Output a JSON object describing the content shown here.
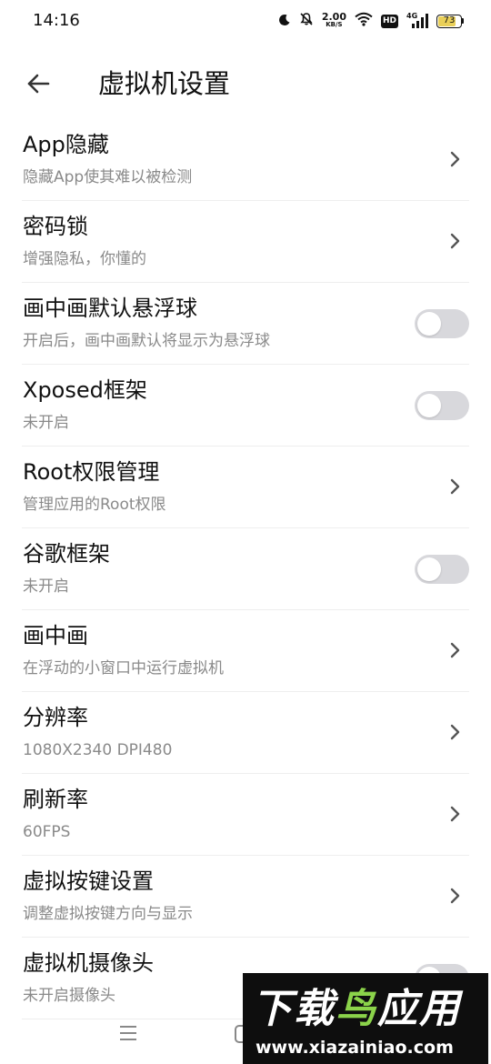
{
  "status_bar": {
    "time": "14:16",
    "speed_value": "2.00",
    "speed_unit": "KB/S",
    "hd_label": "HD",
    "network_label": "4G",
    "battery_level": "73",
    "battery_fill_fraction": 0.73,
    "battery_color": "#e9cf58",
    "icons": [
      "moon-icon",
      "bell-off-icon",
      "wifi-icon",
      "signal-icon",
      "battery-icon"
    ]
  },
  "header": {
    "title": "虚拟机设置",
    "back_icon": "back-arrow-icon"
  },
  "settings": [
    {
      "id": "app-hide",
      "title": "App隐藏",
      "subtitle": "隐藏App使其难以被检测",
      "control": "chevron"
    },
    {
      "id": "password-lock",
      "title": "密码锁",
      "subtitle": "增强隐私，你懂的",
      "control": "chevron"
    },
    {
      "id": "pip-float-ball",
      "title": "画中画默认悬浮球",
      "subtitle": "开启后，画中画默认将显示为悬浮球",
      "control": "toggle",
      "on": false
    },
    {
      "id": "xposed",
      "title": "Xposed框架",
      "subtitle": "未开启",
      "control": "toggle",
      "on": false
    },
    {
      "id": "root",
      "title": "Root权限管理",
      "subtitle": "管理应用的Root权限",
      "control": "chevron"
    },
    {
      "id": "google",
      "title": "谷歌框架",
      "subtitle": "未开启",
      "control": "toggle",
      "on": false
    },
    {
      "id": "pip",
      "title": "画中画",
      "subtitle": "在浮动的小窗口中运行虚拟机",
      "control": "chevron"
    },
    {
      "id": "resolution",
      "title": "分辨率",
      "subtitle": "1080X2340 DPI480",
      "control": "chevron"
    },
    {
      "id": "refresh-rate",
      "title": "刷新率",
      "subtitle": "60FPS",
      "control": "chevron"
    },
    {
      "id": "virtual-keys",
      "title": "虚拟按键设置",
      "subtitle": "调整虚拟按键方向与显示",
      "control": "chevron"
    },
    {
      "id": "camera",
      "title": "虚拟机摄像头",
      "subtitle": "未开启摄像头",
      "control": "toggle",
      "on": false
    }
  ],
  "nav_bar": {
    "icons": [
      "menu-icon",
      "home-icon"
    ]
  },
  "watermark": {
    "text_white_1": "下载",
    "text_green": "鸟",
    "text_white_2": "应用",
    "url": "www.xiazainiao.com",
    "accent_color": "#8bd34a"
  },
  "colors": {
    "toggle_off_track": "#d8d8dc",
    "subtitle_text": "#8a8a8a",
    "chevron": "#555555"
  }
}
